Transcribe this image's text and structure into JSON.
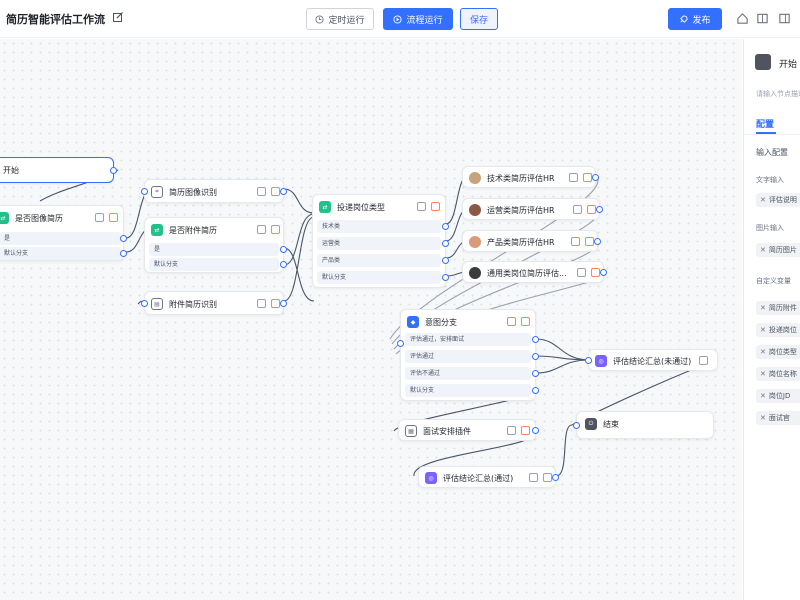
{
  "header": {
    "title": "简历智能评估工作流",
    "schedule_label": "定时运行",
    "run_label": "流程运行",
    "save_label": "保存",
    "publish_label": "发布"
  },
  "nodes": {
    "start": {
      "title": "开始"
    },
    "image_check": {
      "title": "是否图像简历",
      "options": [
        "是",
        "默认分支"
      ]
    },
    "image_recog": {
      "title": "简历图像识别"
    },
    "attachment_check": {
      "title": "是否附件简历",
      "options": [
        "是",
        "默认分支"
      ]
    },
    "attachment_recog": {
      "title": "附件简历识别"
    },
    "position_type": {
      "title": "投递岗位类型",
      "options": [
        "技术类",
        "运营类",
        "产品类",
        "默认分支"
      ]
    },
    "tech_hr": {
      "title": "技术类简历评估HR"
    },
    "ops_hr": {
      "title": "运营类简历评估HR"
    },
    "product_hr": {
      "title": "产品类简历评估HR"
    },
    "general_hr": {
      "title": "通用类岗位简历评估..."
    },
    "intent_branch": {
      "title": "意图分支",
      "options": [
        "评估通过，安排面试",
        "评估通过",
        "评估不通过",
        "默认分支"
      ]
    },
    "summary_fail": {
      "title": "评估结论汇总(未通过)"
    },
    "interview_plugin": {
      "title": "面试安排插件"
    },
    "summary_pass": {
      "title": "评估结论汇总(通过)"
    },
    "end": {
      "title": "结束"
    }
  },
  "panel": {
    "title": "开始",
    "description": "请输入节点描述",
    "tab": "配置",
    "input_section": "输入配置",
    "text_input_label": "文字输入",
    "text_chip": "评估说明",
    "image_input_label": "图片输入",
    "image_chip": "简历图片",
    "custom_vars_label": "自定义变量",
    "custom_vars": [
      "简历附件",
      "投递岗位",
      "岗位类型",
      "岗位名称",
      "岗位JD",
      "面试官"
    ]
  },
  "icons": {
    "edit": "edit-icon",
    "clock": "clock-icon",
    "play": "play-icon",
    "rocket": "rocket-icon",
    "home": "home-icon",
    "book": "book-icon",
    "panel": "panel-toggle-icon"
  },
  "colors": {
    "accent": "#3370ff",
    "node_green": "#22c08a",
    "node_purple": "#7b61ff",
    "delete": "#f08a5d"
  }
}
